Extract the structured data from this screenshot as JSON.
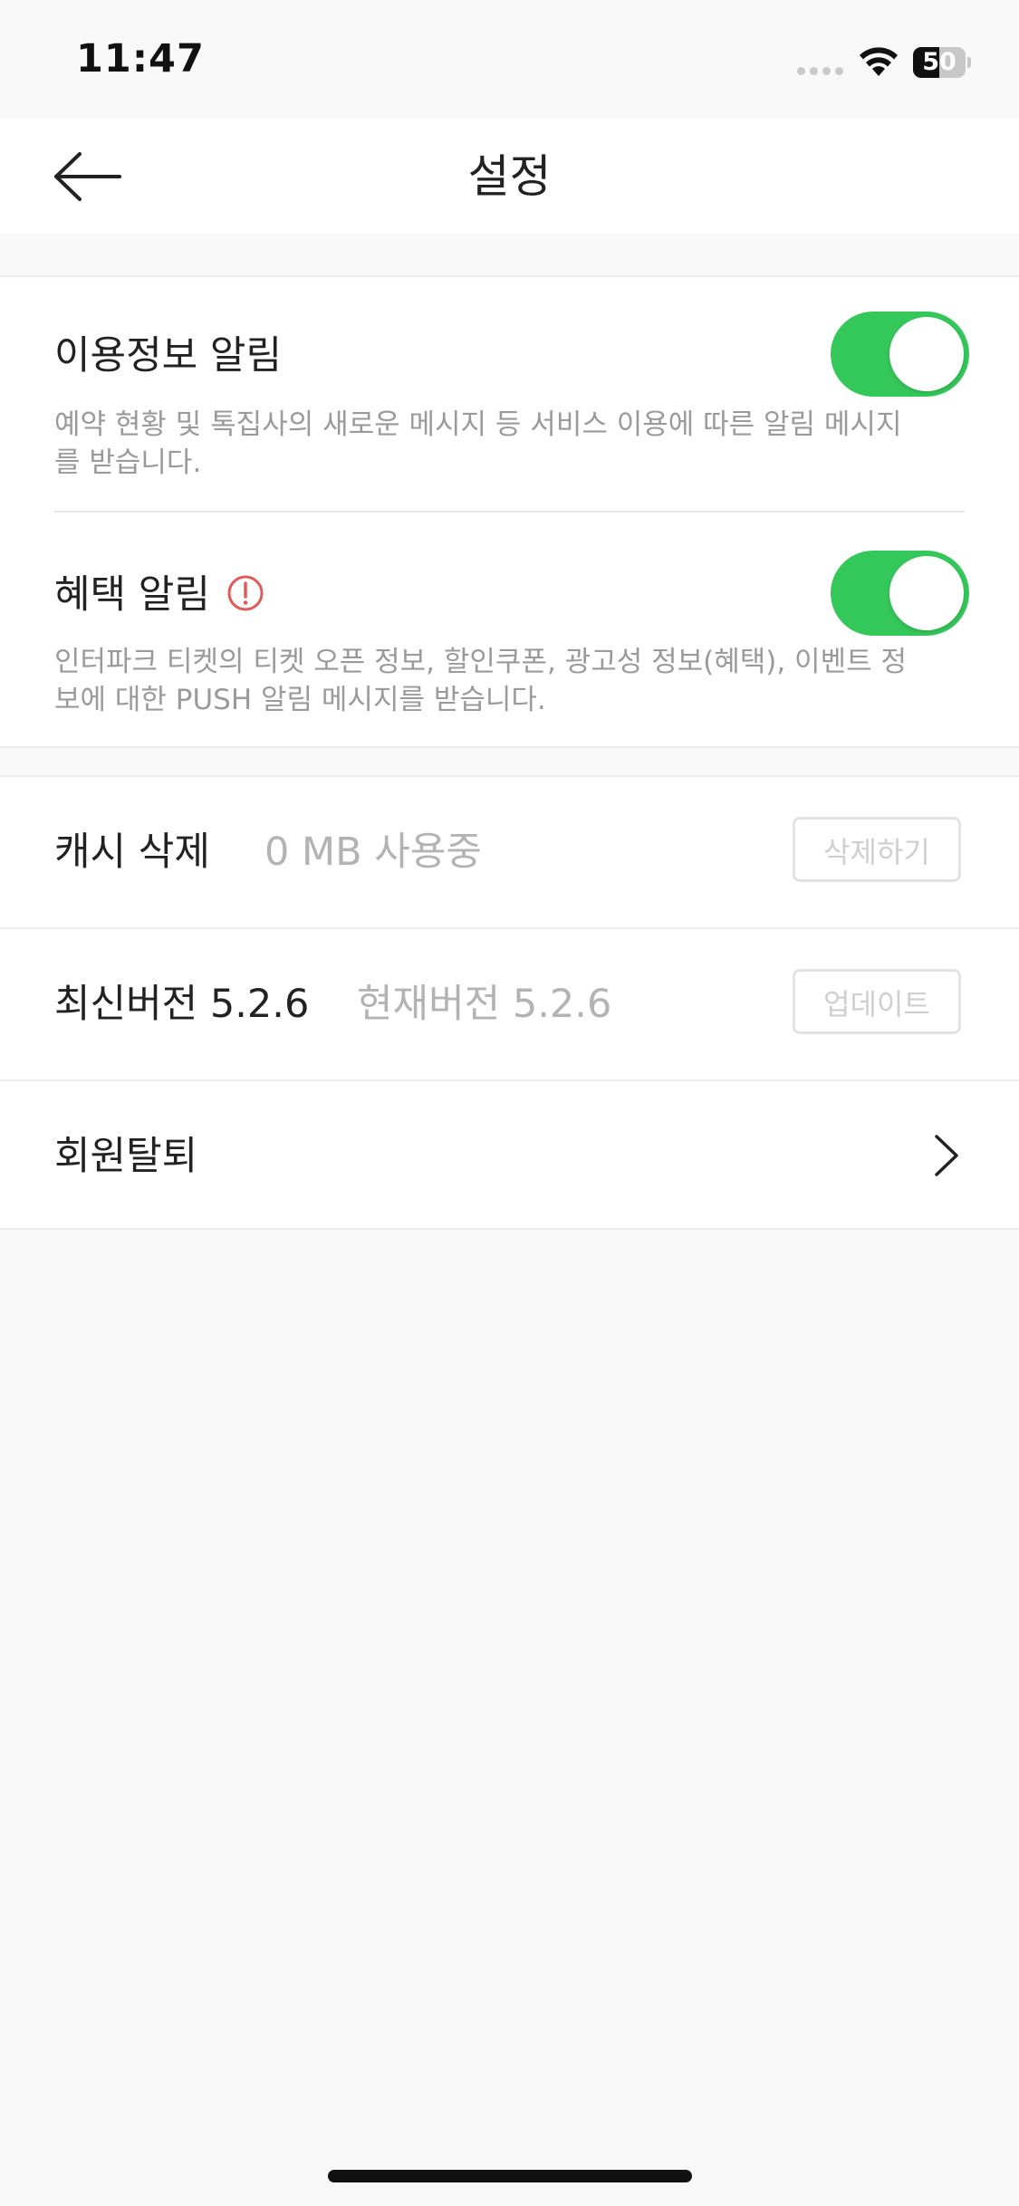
{
  "status_bar": {
    "time": "11:47",
    "battery_level": "50",
    "battery_percent": 50
  },
  "header": {
    "title": "설정",
    "back_icon": "arrow-left-icon"
  },
  "notifications": {
    "usage": {
      "title": "이용정보 알림",
      "description": "예약 현황 및 톡집사의 새로운 메시지 등 서비스 이용에 따른  알림 메시지를 받습니다.",
      "enabled": true
    },
    "benefit": {
      "title": "혜택 알림",
      "info_icon": "exclamation-circle-icon",
      "description": "인터파크 티켓의 티켓 오픈 정보, 할인쿠폰, 광고성 정보(혜택), 이벤트 정보에 대한 PUSH 알림 메시지를 받습니다.",
      "enabled": true
    }
  },
  "settings": {
    "cache": {
      "label": "캐시 삭제",
      "usage": "0 MB 사용중",
      "button": "삭제하기"
    },
    "version": {
      "latest": "최신버전 5.2.6",
      "current": "현재버전 5.2.6",
      "button": "업데이트"
    },
    "withdraw": {
      "label": "회원탈퇴",
      "icon": "chevron-right-icon"
    }
  },
  "colors": {
    "toggle_on": "#34c759",
    "warning": "#e05a5a",
    "background": "#f8f8f8"
  }
}
